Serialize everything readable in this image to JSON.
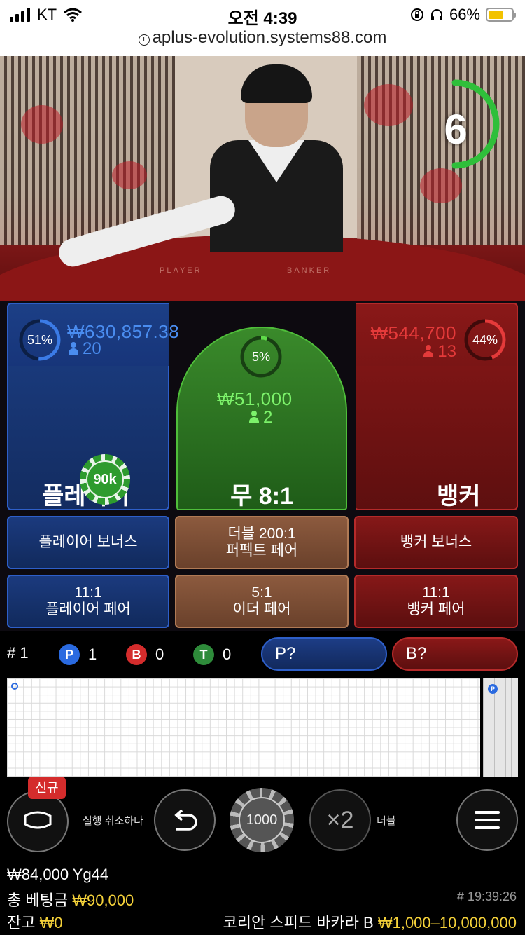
{
  "status_bar": {
    "carrier": "KT",
    "time": "오전 4:39",
    "battery_pct": "66%",
    "url": "aplus-evolution.systems88.com"
  },
  "video": {
    "countdown": "6",
    "felt_left": "PLAYER",
    "felt_right": "BANKER"
  },
  "bets": {
    "player": {
      "pct": "51%",
      "amount": "₩630,857.38",
      "count": "20",
      "label": "플레이어",
      "color": "#3b7be6"
    },
    "tie": {
      "pct": "5%",
      "amount": "₩51,000",
      "count": "2",
      "label": "무 8:1",
      "color": "#5fdc4a"
    },
    "banker": {
      "pct": "44%",
      "amount": "₩544,700",
      "count": "13",
      "label": "뱅커",
      "color": "#e53a3a"
    },
    "chip_on_player": "90k"
  },
  "side_bets": {
    "player_bonus": "플레이어 보너스",
    "perfect_pair_line1": "더블 200:1",
    "perfect_pair_line2": "퍼펙트 페어",
    "banker_bonus": "뱅커 보너스",
    "player_pair_line1": "11:1",
    "player_pair_line2": "플레이어 페어",
    "either_pair_line1": "5:1",
    "either_pair_line2": "이더 페어",
    "banker_pair_line1": "11:1",
    "banker_pair_line2": "뱅커 페어"
  },
  "stats": {
    "round": "# 1",
    "p_letter": "P",
    "p_count": "1",
    "b_letter": "B",
    "b_count": "0",
    "t_letter": "T",
    "t_count": "0",
    "player_predict": "P?",
    "banker_predict": "B?"
  },
  "road": {
    "side_letter": "P"
  },
  "controls": {
    "new_badge": "신규",
    "undo_label": "실행 취소하다",
    "chip_value": "1000",
    "double_symbol": "×2",
    "double_label": "더블"
  },
  "footer": {
    "balance_line": "₩84,000 Yg44",
    "total_bet_label": "총 베팅금",
    "total_bet_value": "₩90,000",
    "balance_label": "잔고",
    "balance_value": "₩0",
    "round_id": "# 19:39:26",
    "table_name": "코리안 스피드 바카라 B",
    "limits": "₩1,000–10,000,000"
  }
}
